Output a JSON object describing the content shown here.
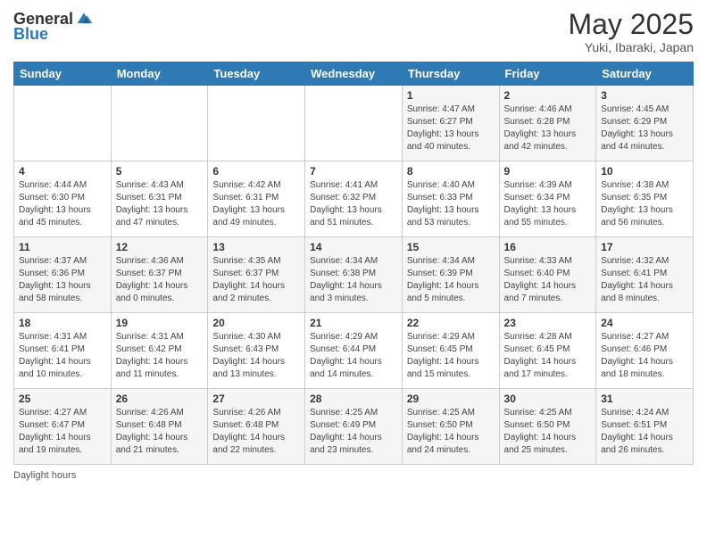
{
  "header": {
    "logo_general": "General",
    "logo_blue": "Blue",
    "month": "May 2025",
    "location": "Yuki, Ibaraki, Japan"
  },
  "days_of_week": [
    "Sunday",
    "Monday",
    "Tuesday",
    "Wednesday",
    "Thursday",
    "Friday",
    "Saturday"
  ],
  "weeks": [
    [
      {
        "day": "",
        "info": ""
      },
      {
        "day": "",
        "info": ""
      },
      {
        "day": "",
        "info": ""
      },
      {
        "day": "",
        "info": ""
      },
      {
        "day": "1",
        "info": "Sunrise: 4:47 AM\nSunset: 6:27 PM\nDaylight: 13 hours\nand 40 minutes."
      },
      {
        "day": "2",
        "info": "Sunrise: 4:46 AM\nSunset: 6:28 PM\nDaylight: 13 hours\nand 42 minutes."
      },
      {
        "day": "3",
        "info": "Sunrise: 4:45 AM\nSunset: 6:29 PM\nDaylight: 13 hours\nand 44 minutes."
      }
    ],
    [
      {
        "day": "4",
        "info": "Sunrise: 4:44 AM\nSunset: 6:30 PM\nDaylight: 13 hours\nand 45 minutes."
      },
      {
        "day": "5",
        "info": "Sunrise: 4:43 AM\nSunset: 6:31 PM\nDaylight: 13 hours\nand 47 minutes."
      },
      {
        "day": "6",
        "info": "Sunrise: 4:42 AM\nSunset: 6:31 PM\nDaylight: 13 hours\nand 49 minutes."
      },
      {
        "day": "7",
        "info": "Sunrise: 4:41 AM\nSunset: 6:32 PM\nDaylight: 13 hours\nand 51 minutes."
      },
      {
        "day": "8",
        "info": "Sunrise: 4:40 AM\nSunset: 6:33 PM\nDaylight: 13 hours\nand 53 minutes."
      },
      {
        "day": "9",
        "info": "Sunrise: 4:39 AM\nSunset: 6:34 PM\nDaylight: 13 hours\nand 55 minutes."
      },
      {
        "day": "10",
        "info": "Sunrise: 4:38 AM\nSunset: 6:35 PM\nDaylight: 13 hours\nand 56 minutes."
      }
    ],
    [
      {
        "day": "11",
        "info": "Sunrise: 4:37 AM\nSunset: 6:36 PM\nDaylight: 13 hours\nand 58 minutes."
      },
      {
        "day": "12",
        "info": "Sunrise: 4:36 AM\nSunset: 6:37 PM\nDaylight: 14 hours\nand 0 minutes."
      },
      {
        "day": "13",
        "info": "Sunrise: 4:35 AM\nSunset: 6:37 PM\nDaylight: 14 hours\nand 2 minutes."
      },
      {
        "day": "14",
        "info": "Sunrise: 4:34 AM\nSunset: 6:38 PM\nDaylight: 14 hours\nand 3 minutes."
      },
      {
        "day": "15",
        "info": "Sunrise: 4:34 AM\nSunset: 6:39 PM\nDaylight: 14 hours\nand 5 minutes."
      },
      {
        "day": "16",
        "info": "Sunrise: 4:33 AM\nSunset: 6:40 PM\nDaylight: 14 hours\nand 7 minutes."
      },
      {
        "day": "17",
        "info": "Sunrise: 4:32 AM\nSunset: 6:41 PM\nDaylight: 14 hours\nand 8 minutes."
      }
    ],
    [
      {
        "day": "18",
        "info": "Sunrise: 4:31 AM\nSunset: 6:41 PM\nDaylight: 14 hours\nand 10 minutes."
      },
      {
        "day": "19",
        "info": "Sunrise: 4:31 AM\nSunset: 6:42 PM\nDaylight: 14 hours\nand 11 minutes."
      },
      {
        "day": "20",
        "info": "Sunrise: 4:30 AM\nSunset: 6:43 PM\nDaylight: 14 hours\nand 13 minutes."
      },
      {
        "day": "21",
        "info": "Sunrise: 4:29 AM\nSunset: 6:44 PM\nDaylight: 14 hours\nand 14 minutes."
      },
      {
        "day": "22",
        "info": "Sunrise: 4:29 AM\nSunset: 6:45 PM\nDaylight: 14 hours\nand 15 minutes."
      },
      {
        "day": "23",
        "info": "Sunrise: 4:28 AM\nSunset: 6:45 PM\nDaylight: 14 hours\nand 17 minutes."
      },
      {
        "day": "24",
        "info": "Sunrise: 4:27 AM\nSunset: 6:46 PM\nDaylight: 14 hours\nand 18 minutes."
      }
    ],
    [
      {
        "day": "25",
        "info": "Sunrise: 4:27 AM\nSunset: 6:47 PM\nDaylight: 14 hours\nand 19 minutes."
      },
      {
        "day": "26",
        "info": "Sunrise: 4:26 AM\nSunset: 6:48 PM\nDaylight: 14 hours\nand 21 minutes."
      },
      {
        "day": "27",
        "info": "Sunrise: 4:26 AM\nSunset: 6:48 PM\nDaylight: 14 hours\nand 22 minutes."
      },
      {
        "day": "28",
        "info": "Sunrise: 4:25 AM\nSunset: 6:49 PM\nDaylight: 14 hours\nand 23 minutes."
      },
      {
        "day": "29",
        "info": "Sunrise: 4:25 AM\nSunset: 6:50 PM\nDaylight: 14 hours\nand 24 minutes."
      },
      {
        "day": "30",
        "info": "Sunrise: 4:25 AM\nSunset: 6:50 PM\nDaylight: 14 hours\nand 25 minutes."
      },
      {
        "day": "31",
        "info": "Sunrise: 4:24 AM\nSunset: 6:51 PM\nDaylight: 14 hours\nand 26 minutes."
      }
    ]
  ],
  "footer": {
    "daylight_label": "Daylight hours"
  }
}
